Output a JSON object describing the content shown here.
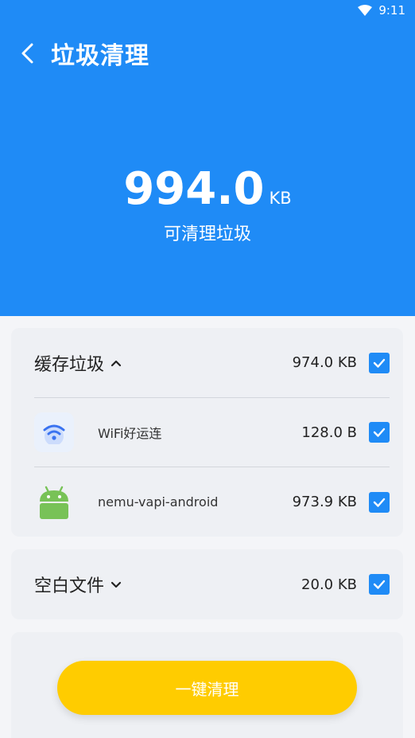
{
  "status_bar": {
    "time": "9:11"
  },
  "header": {
    "title": "垃圾清理",
    "total_size": "994.0",
    "total_unit": "KB",
    "caption": "可清理垃圾"
  },
  "cache_group": {
    "label": "缓存垃圾",
    "size": "974.0 KB",
    "expanded": true,
    "checked": true,
    "items": [
      {
        "name": "WiFi好运连",
        "size": "128.0 B",
        "checked": true,
        "icon": "wifi-app-icon"
      },
      {
        "name": "nemu-vapi-android",
        "size": "973.9 KB",
        "checked": true,
        "icon": "android-icon"
      }
    ]
  },
  "empty_files_group": {
    "label": "空白文件",
    "size": "20.0 KB",
    "expanded": false,
    "checked": true
  },
  "action": {
    "clean_label": "一键清理"
  },
  "colors": {
    "primary": "#1f8bf6",
    "button": "#ffcc00",
    "background": "#f4f5f8"
  }
}
